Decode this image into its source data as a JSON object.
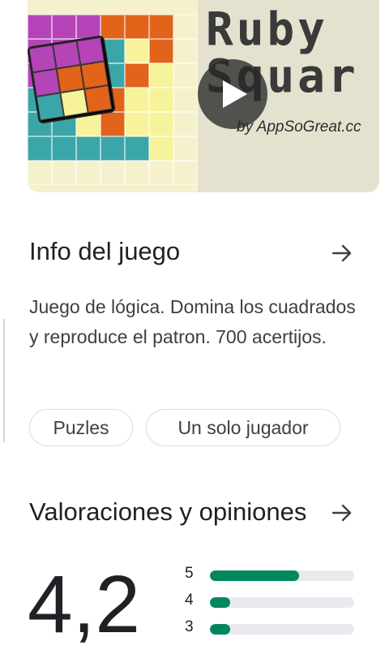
{
  "media": {
    "logo_line1": "Ruby",
    "logo_line2": "Squar",
    "byline": "by AppSoGreat.cc",
    "accent_colors": {
      "magenta": "#b544b8",
      "orange": "#e2631a",
      "teal": "#3aa6a8",
      "yellow": "#f7f39a",
      "cream": "#f6f1cd"
    }
  },
  "about": {
    "title": "Info del juego",
    "description": "Juego de lógica. Domina los cuadrados y reproduce el patron. 700 acertijos.",
    "tags": [
      "Puzles",
      "Un solo jugador"
    ]
  },
  "ratings": {
    "title": "Valoraciones y opiniones",
    "score": "4,2",
    "bars": [
      {
        "label": "5",
        "fraction": 0.62
      },
      {
        "label": "4",
        "fraction": 0.14
      },
      {
        "label": "3",
        "fraction": 0.14
      }
    ],
    "bar_color": "#01875f"
  }
}
